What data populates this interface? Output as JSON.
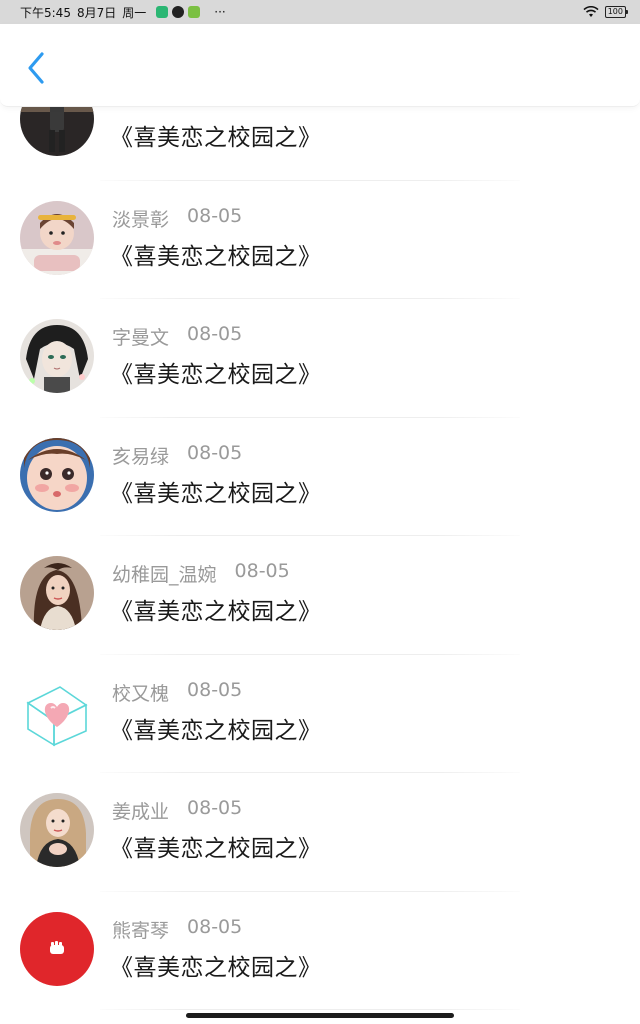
{
  "statusbar": {
    "time": "下午5:45",
    "date": "8月7日",
    "weekday": "周一",
    "more": "···",
    "battery": "100"
  },
  "navbar": {
    "back_icon": "chevron-left-icon",
    "accent": "#2e9bf0"
  },
  "list": {
    "items": [
      {
        "author": "",
        "date": "",
        "title": "《喜美恋之校园之》",
        "avatar": "sports-player"
      },
      {
        "author": "淡景彰",
        "date": "08-05",
        "title": "《喜美恋之校园之》",
        "avatar": "child-photo"
      },
      {
        "author": "字曼文",
        "date": "08-05",
        "title": "《喜美恋之校园之》",
        "avatar": "anime-character"
      },
      {
        "author": "亥易绿",
        "date": "08-05",
        "title": "《喜美恋之校园之》",
        "avatar": "baby-face"
      },
      {
        "author": "幼稚园_温婉",
        "date": "08-05",
        "title": "《喜美恋之校园之》",
        "avatar": "woman-portrait"
      },
      {
        "author": "校又槐",
        "date": "08-05",
        "title": "《喜美恋之校园之》",
        "avatar": "heart-cube"
      },
      {
        "author": "姜成业",
        "date": "08-05",
        "title": "《喜美恋之校园之》",
        "avatar": "woman-selfie"
      },
      {
        "author": "熊寄琴",
        "date": "08-05",
        "title": "《喜美恋之校园之》",
        "avatar": "red-fist"
      }
    ]
  }
}
